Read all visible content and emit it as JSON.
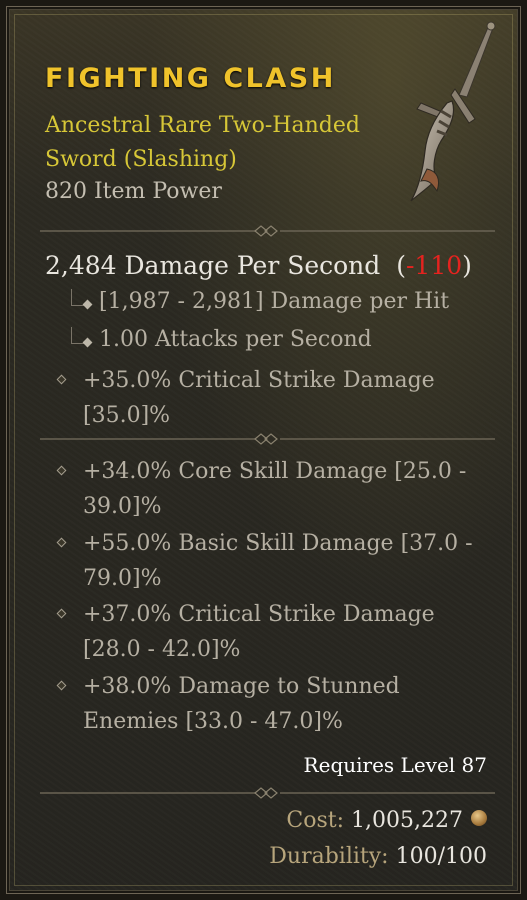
{
  "item": {
    "name": "FIGHTING CLASH",
    "type_line": "Ancestral Rare Two-Handed Sword (Slashing)",
    "item_power": "820 Item Power",
    "icon": "two-handed-sword-icon"
  },
  "damage": {
    "dps_value": "2,484 Damage Per Second",
    "open_paren": "(",
    "dps_diff": "-110",
    "close_paren": ")",
    "per_hit": "[1,987 - 2,981] Damage per Hit",
    "attack_speed": "1.00 Attacks per Second"
  },
  "implicit": {
    "text": "+35.0% Critical Strike Damage [35.0]%"
  },
  "affixes": [
    {
      "text": "+34.0% Core Skill Damage [25.0 - 39.0]%"
    },
    {
      "text": "+55.0% Basic Skill Damage [37.0 - 79.0]%"
    },
    {
      "text": "+37.0% Critical Strike Damage [28.0 - 42.0]%"
    },
    {
      "text": "+38.0% Damage to Stunned Enemies [33.0 - 47.0]%"
    }
  ],
  "requirements": "Requires Level 87",
  "cost": {
    "label": "Cost:",
    "value": "1,005,227",
    "icon": "gold-coin-icon"
  },
  "durability": {
    "label": "Durability:",
    "value": "100/100"
  },
  "colors": {
    "title": "#f0c32b",
    "rare": "#d7c737",
    "negative": "#e5231f",
    "text": "#b6b0a3"
  }
}
